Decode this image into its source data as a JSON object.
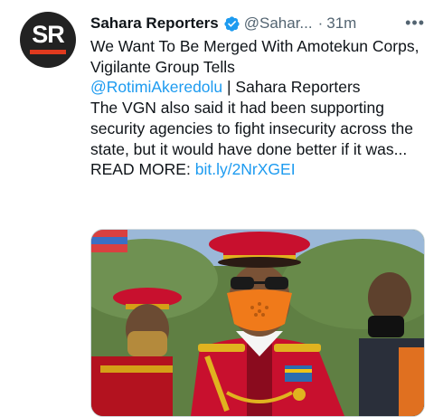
{
  "tweet": {
    "author_name": "Sahara Reporters",
    "handle": "@Sahar...",
    "separator": "·",
    "time": "31m",
    "more_label": "•••",
    "avatar_text": "SR",
    "headline_line": "We Want To Be Merged With Amotekun Corps, Vigilante Group Tells",
    "mention": "@RotimiAkeredolu",
    "mention_suffix": " | Sahara Reporters",
    "summary": "The VGN also said it had been supporting security agencies to fight insecurity across the state, but it would have done better if it was...",
    "read_more_label": "READ MORE: ",
    "read_more_link": "bit.ly/2NrXGEI"
  },
  "colors": {
    "link": "#1d9bf0",
    "verified": "#1d9bf0",
    "avatar_bg": "#222222",
    "avatar_bar": "#e03a1e",
    "uniform_red": "#c8102e",
    "mask_orange": "#f07a1a"
  },
  "icons": {
    "verified": "verified-badge-icon",
    "more": "more-horizontal-icon"
  }
}
